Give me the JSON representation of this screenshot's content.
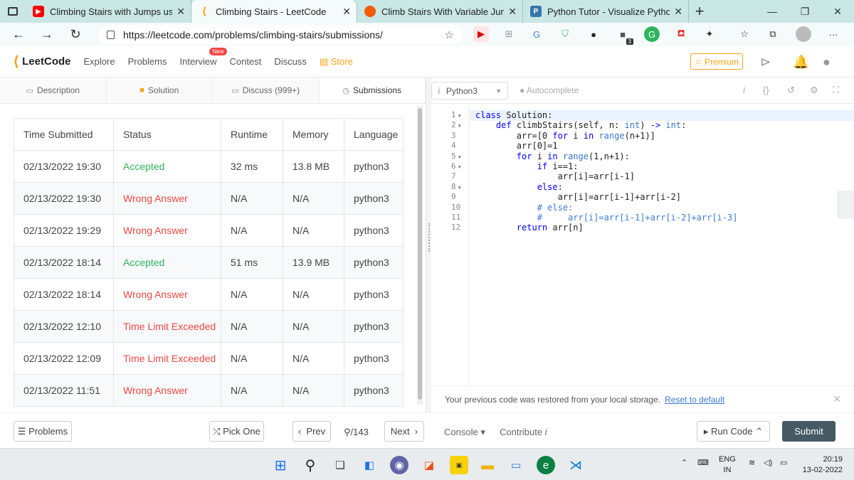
{
  "browser": {
    "tabs": [
      {
        "title": "Climbing Stairs with Jumps using",
        "icon": "youtube-icon",
        "color": "#ff0000",
        "active": false
      },
      {
        "title": "Climbing Stairs - LeetCode",
        "icon": "leetcode-icon",
        "color": "#ffa116",
        "active": true
      },
      {
        "title": "Climb Stairs With Variable Jumps",
        "icon": "pepcoding-icon",
        "color": "#f25c05",
        "active": false
      },
      {
        "title": "Python Tutor - Visualize Python,",
        "icon": "python-icon",
        "color": "#3776ab",
        "active": false
      }
    ],
    "url": "https://leetcode.com/problems/climbing-stairs/submissions/",
    "ext_badge": "3"
  },
  "nav": {
    "logo": "LeetCode",
    "items": [
      "Explore",
      "Problems",
      "Interview",
      "Contest",
      "Discuss"
    ],
    "new_badge": "New",
    "store": "Store",
    "premium": "Premium"
  },
  "subtabs": [
    {
      "label": "Description",
      "icon": "description-icon"
    },
    {
      "label": "Solution",
      "icon": "lock-icon"
    },
    {
      "label": "Discuss (999+)",
      "icon": "discuss-icon"
    },
    {
      "label": "Submissions",
      "icon": "clock-icon"
    }
  ],
  "submissions": {
    "headers": [
      "Time Submitted",
      "Status",
      "Runtime",
      "Memory",
      "Language"
    ],
    "rows": [
      {
        "time": "02/13/2022 19:30",
        "status": "Accepted",
        "runtime": "32 ms",
        "memory": "13.8 MB",
        "lang": "python3"
      },
      {
        "time": "02/13/2022 19:30",
        "status": "Wrong Answer",
        "runtime": "N/A",
        "memory": "N/A",
        "lang": "python3"
      },
      {
        "time": "02/13/2022 19:29",
        "status": "Wrong Answer",
        "runtime": "N/A",
        "memory": "N/A",
        "lang": "python3"
      },
      {
        "time": "02/13/2022 18:14",
        "status": "Accepted",
        "runtime": "51 ms",
        "memory": "13.9 MB",
        "lang": "python3"
      },
      {
        "time": "02/13/2022 18:14",
        "status": "Wrong Answer",
        "runtime": "N/A",
        "memory": "N/A",
        "lang": "python3"
      },
      {
        "time": "02/13/2022 12:10",
        "status": "Time Limit Exceeded",
        "runtime": "N/A",
        "memory": "N/A",
        "lang": "python3"
      },
      {
        "time": "02/13/2022 12:09",
        "status": "Time Limit Exceeded",
        "runtime": "N/A",
        "memory": "N/A",
        "lang": "python3"
      },
      {
        "time": "02/13/2022 11:51",
        "status": "Wrong Answer",
        "runtime": "N/A",
        "memory": "N/A",
        "lang": "python3"
      }
    ]
  },
  "editor": {
    "language": "Python3",
    "autocomplete": "Autocomplete",
    "lines": [
      "class Solution:",
      "    def climbStairs(self, n: int) -> int:",
      "        arr=[0 for i in range(n+1)]",
      "        arr[0]=1",
      "        for i in range(1,n+1):",
      "            if i==1:",
      "                arr[i]=arr[i-1]",
      "            else:",
      "                arr[i]=arr[i-1]+arr[i-2]",
      "            # else:",
      "            #     arr[i]=arr[i-1]+arr[i-2]+arr[i-3]",
      "        return arr[n]"
    ],
    "fold_lines": [
      1,
      2,
      5,
      6,
      8
    ],
    "restore_msg": "Your previous code was restored from your local storage.",
    "reset_label": "Reset to default"
  },
  "bottom": {
    "problems": "Problems",
    "pick_one": "Pick One",
    "prev": "Prev",
    "page": "/143",
    "next": "Next",
    "console": "Console",
    "contribute": "Contribute",
    "run_code": "Run Code",
    "submit": "Submit"
  },
  "taskbar": {
    "lang1": "ENG",
    "lang2": "IN",
    "time": "20:19",
    "date": "13-02-2022"
  }
}
